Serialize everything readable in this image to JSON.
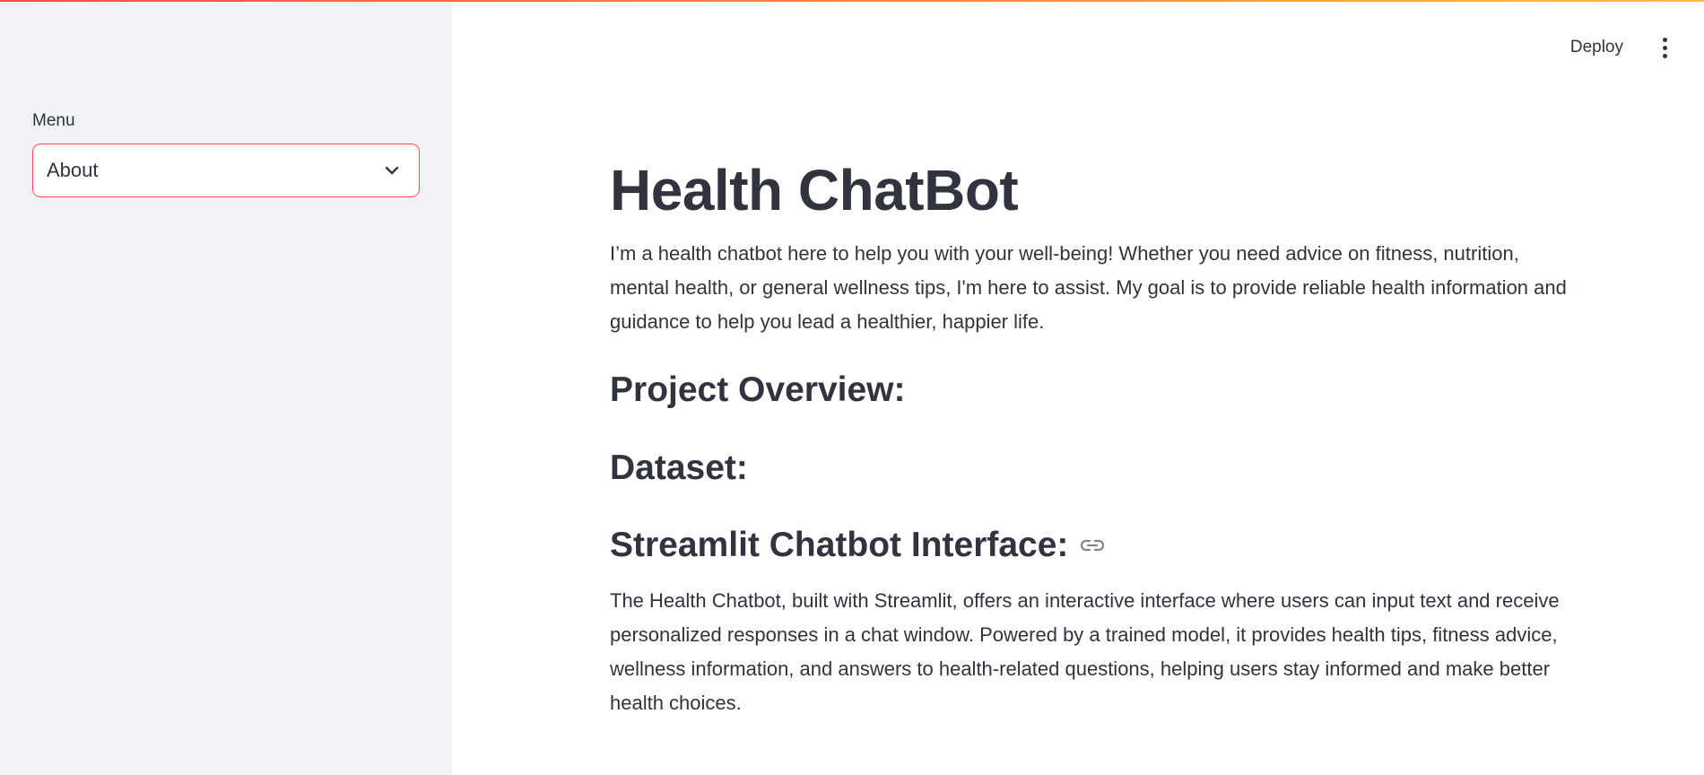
{
  "sidebar": {
    "menu_label": "Menu",
    "select": {
      "value": "About"
    }
  },
  "header": {
    "deploy_label": "Deploy"
  },
  "main": {
    "title": "Health ChatBot",
    "intro": "I’m a health chatbot here to help you with your well-being! Whether you need advice on fitness, nutrition, mental health, or general wellness tips, I'm here to assist. My goal is to provide reliable health information and guidance to help you lead a healthier, happier life.",
    "sections": [
      {
        "heading": "Project Overview:"
      },
      {
        "heading": "Dataset:"
      },
      {
        "heading": "Streamlit Chatbot Interface:",
        "text": "The Health Chatbot, built with Streamlit, offers an interactive interface where users can input text and receive personalized responses in a chat window. Powered by a trained model, it provides health tips, fitness advice, wellness information, and answers to health-related questions, helping users stay informed and make better health choices."
      }
    ]
  },
  "colors": {
    "accent": "#ff4b4b",
    "sidebar_bg": "#f0f2f6",
    "text": "#31333f",
    "decoration_end": "#ffbd45"
  },
  "icons": [
    "chevron-down-icon",
    "more-vert-icon",
    "link-icon"
  ]
}
